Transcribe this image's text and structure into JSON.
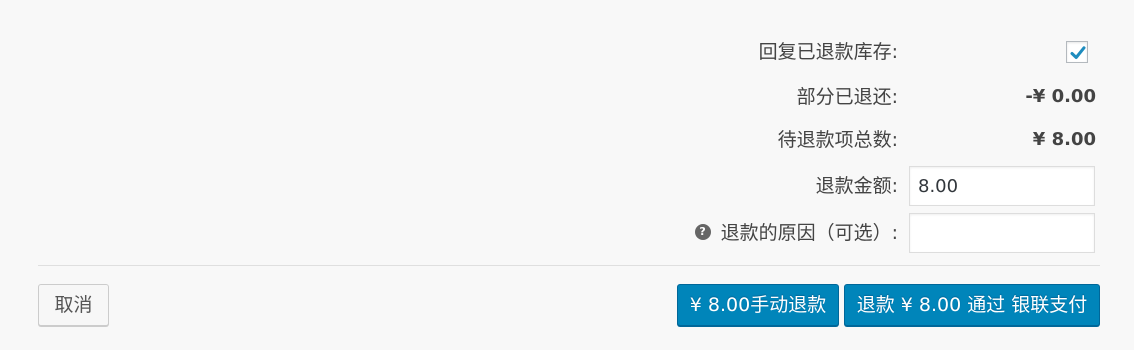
{
  "refund": {
    "restock": {
      "label": "回复已退款库存:",
      "checked": true
    },
    "already_refunded": {
      "label": "部分已退还:",
      "value": "-¥ 0.00"
    },
    "available": {
      "label": "待退款项总数:",
      "value": "¥ 8.00"
    },
    "amount": {
      "label": "退款金额:",
      "value": "8.00"
    },
    "reason": {
      "label": "退款的原因（可选）:",
      "value": "",
      "help_icon": "help-question-icon"
    }
  },
  "actions": {
    "cancel_label": "取消",
    "manual_label": "¥ 8.00手动退款",
    "gateway_label": "退款 ¥ 8.00 通过 银联支付"
  },
  "colors": {
    "primary": "#0085ba",
    "checkmark": "#1e8cbe",
    "background": "#f8f8f8"
  }
}
